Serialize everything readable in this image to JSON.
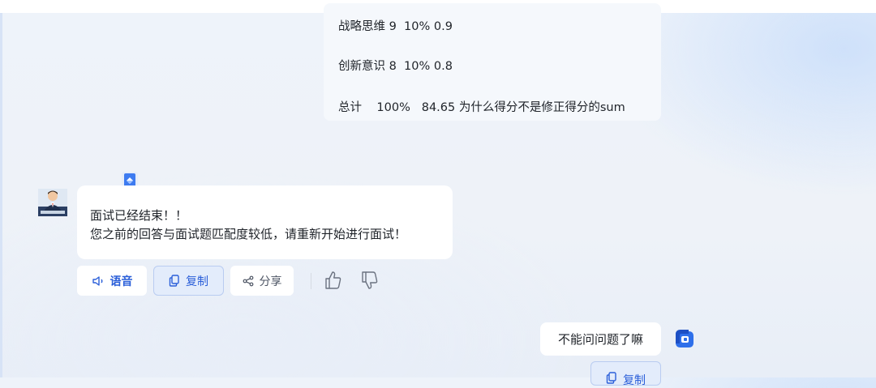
{
  "previous_message": {
    "lines": [
      "战略思维 9  10% 0.9",
      "创新意识 8  10% 0.8",
      "总计    100%   84.65 为什么得分不是修正得分的sum"
    ]
  },
  "bot_message": {
    "lines": [
      "面试已经结束！！",
      "您之前的回答与面试题匹配度较低，请重新开始进行面试！"
    ],
    "icons": {
      "avatar": "interviewer-avatar-icon",
      "badge": "document-icon"
    }
  },
  "actions": {
    "voice_label": "语音",
    "copy_label": "复制",
    "share_label": "分享",
    "icons": {
      "voice": "speaker-icon",
      "copy": "copy-icon",
      "share": "share-icon",
      "like": "thumbs-up-icon",
      "dislike": "thumbs-down-icon"
    }
  },
  "user_message": {
    "text": "不能问问题了嘛",
    "copy_label": "复制"
  },
  "colors": {
    "accent": "#2b5fd9",
    "background": "#eef3fa",
    "bubble": "#ffffff"
  }
}
